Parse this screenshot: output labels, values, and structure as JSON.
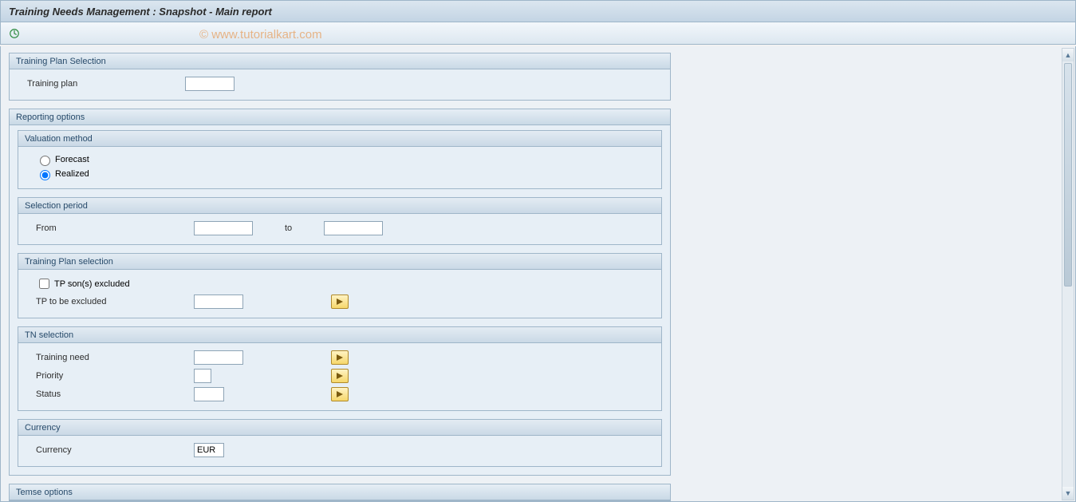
{
  "watermark": "© www.tutorialkart.com",
  "header": {
    "title": "Training Needs Management : Snapshot - Main report"
  },
  "sections": {
    "training_plan_selection": {
      "title": "Training Plan Selection",
      "field_label": "Training plan",
      "value": ""
    },
    "reporting_options": {
      "title": "Reporting options",
      "valuation_method": {
        "title": "Valuation method",
        "forecast_label": "Forecast",
        "realized_label": "Realized",
        "selected": "realized"
      },
      "selection_period": {
        "title": "Selection period",
        "from_label": "From",
        "to_label": "to",
        "from_value": "",
        "to_value": ""
      },
      "tp_selection": {
        "title": "Training Plan selection",
        "excluded_checkbox_label": "TP son(s) excluded",
        "excluded_checked": false,
        "to_be_excluded_label": "TP to be excluded",
        "to_be_excluded_value": ""
      },
      "tn_selection": {
        "title": "TN selection",
        "training_need_label": "Training need",
        "training_need_value": "",
        "priority_label": "Priority",
        "priority_value": "",
        "status_label": "Status",
        "status_value": ""
      },
      "currency": {
        "title": "Currency",
        "label": "Currency",
        "value": "EUR"
      }
    },
    "temse_options": {
      "title": "Temse options"
    }
  }
}
